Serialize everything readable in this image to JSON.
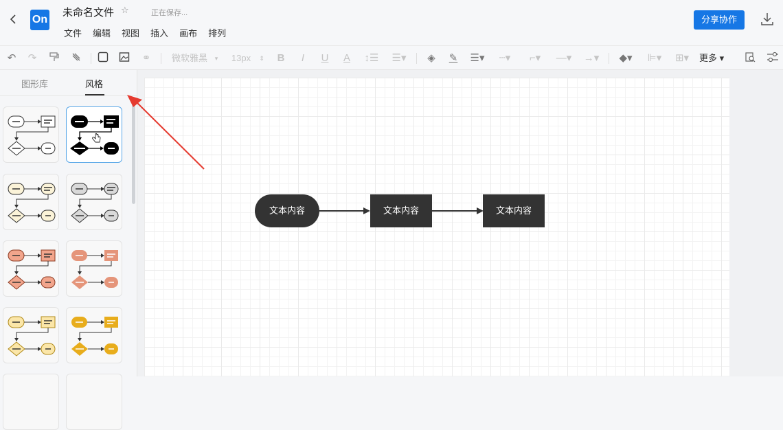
{
  "header": {
    "back_icon": "chevron-left-icon",
    "logo_text": "On",
    "title": "未命名文件",
    "star_icon": "star-outline-icon",
    "saving_status": "正在保存...",
    "menu": [
      "文件",
      "编辑",
      "视图",
      "插入",
      "画布",
      "排列"
    ],
    "share_label": "分享协作",
    "download_icon": "download-icon"
  },
  "toolbar": {
    "font_family": "微软雅黑",
    "font_size": "13px",
    "more_label": "更多"
  },
  "sidebar": {
    "tabs": [
      "图形库",
      "风格"
    ],
    "active_tab": 1
  },
  "canvas": {
    "nodes": [
      "文本内容",
      "文本内容",
      "文本内容"
    ]
  },
  "colors": {
    "accent": "#1677e5",
    "node_fill": "#333333",
    "annotation_arrow": "#e53a2f",
    "style_selected_border": "#58a7e8"
  }
}
